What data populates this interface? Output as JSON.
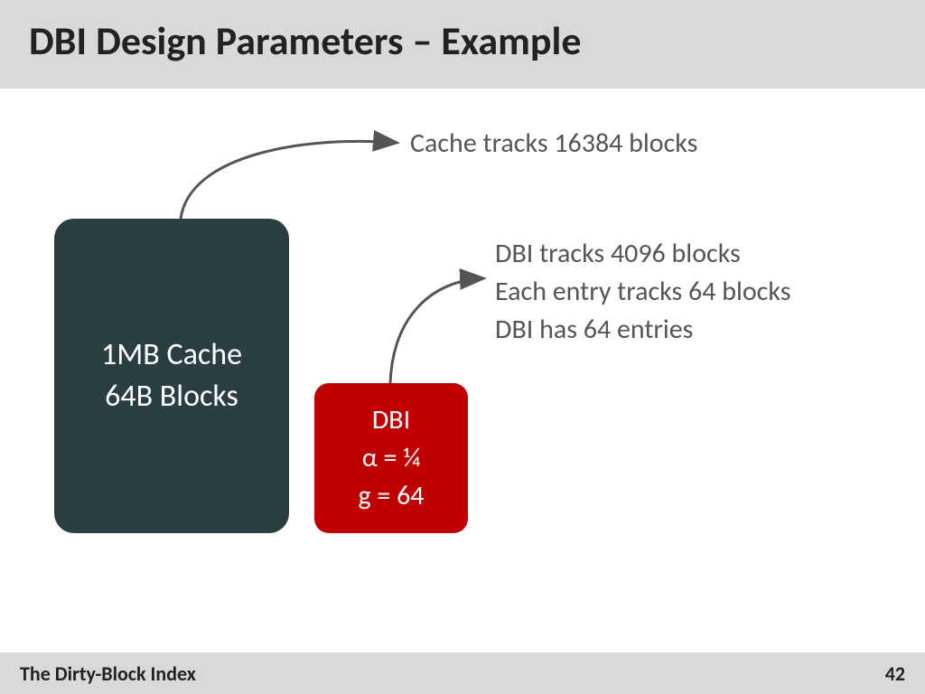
{
  "title": "DBI Design Parameters – Example",
  "footer": {
    "left": "The Dirty-Block Index",
    "page": "42"
  },
  "annotations": {
    "cache_tracks": "Cache tracks 16384 blocks",
    "dbi_tracks": "DBI tracks 4096 blocks",
    "entry_tracks": "Each entry tracks 64 blocks",
    "dbi_entries": "DBI has 64 entries"
  },
  "cache_box": {
    "line1": "1MB Cache",
    "line2": "64B Blocks"
  },
  "dbi_box": {
    "line1": "DBI",
    "line2": "α = ¼",
    "line3": "g = 64"
  }
}
